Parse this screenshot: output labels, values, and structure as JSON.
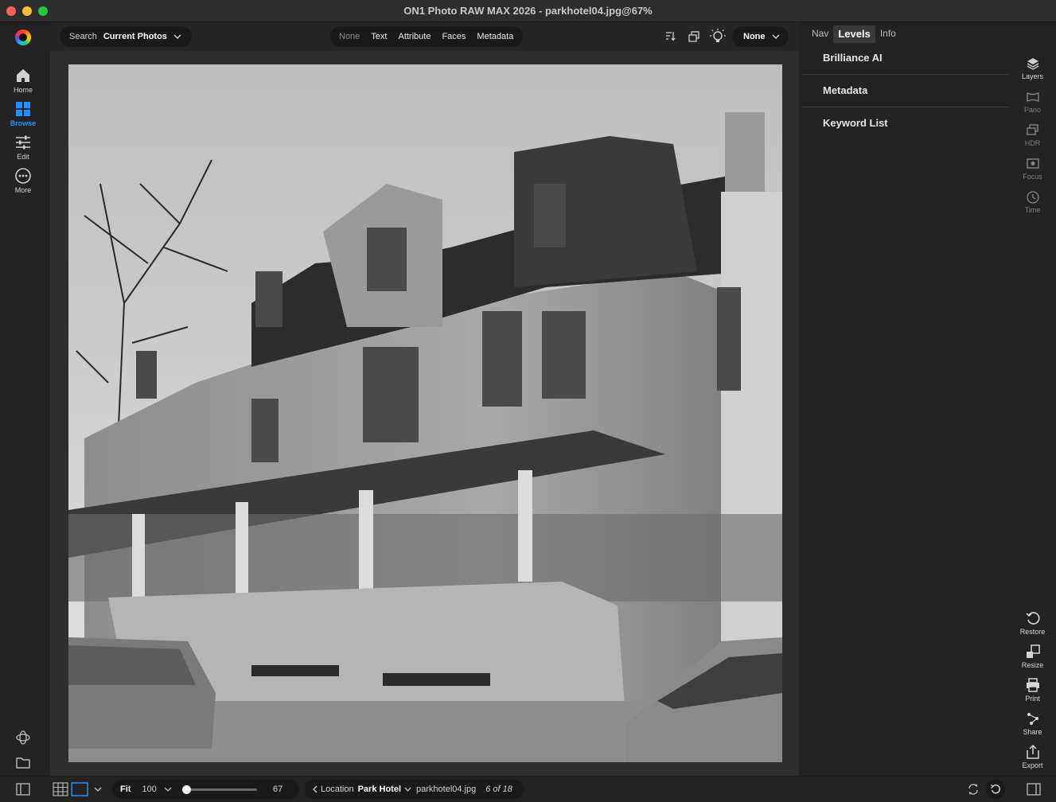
{
  "window": {
    "title": "ON1 Photo RAW MAX 2026 - parkhotel04.jpg@67%"
  },
  "left_nav": {
    "items": [
      {
        "label": "Home",
        "icon": "home-icon"
      },
      {
        "label": "Browse",
        "icon": "grid-icon",
        "active": true
      },
      {
        "label": "Edit",
        "icon": "sliders-icon"
      },
      {
        "label": "More",
        "icon": "more-icon"
      }
    ]
  },
  "top_bar": {
    "search_label": "Search",
    "search_value": "Current Photos",
    "filters": [
      "None",
      "Text",
      "Attribute",
      "Faces",
      "Metadata"
    ],
    "preset_value": "None"
  },
  "right_panel": {
    "tabs": [
      "Nav",
      "Levels",
      "Info"
    ],
    "active_tab": "Levels",
    "sections": [
      "Brilliance AI",
      "Metadata",
      "Keyword List"
    ]
  },
  "tool_rail": {
    "top": [
      "Layers",
      "Pano",
      "HDR",
      "Focus",
      "Time"
    ],
    "bottom": [
      "Restore",
      "Resize",
      "Print",
      "Share",
      "Export"
    ]
  },
  "bottom_bar": {
    "fit_label": "Fit",
    "zoom_value": "100",
    "zoom_slider_fraction": 0.0,
    "zoom_percent": "67",
    "location_label": "Location",
    "location_value": "Park Hotel",
    "filename": "parkhotel04.jpg",
    "count": "6 of 18"
  },
  "colors": {
    "accent": "#1e90ff",
    "background": "#232323",
    "pill": "#1a1a1a"
  }
}
